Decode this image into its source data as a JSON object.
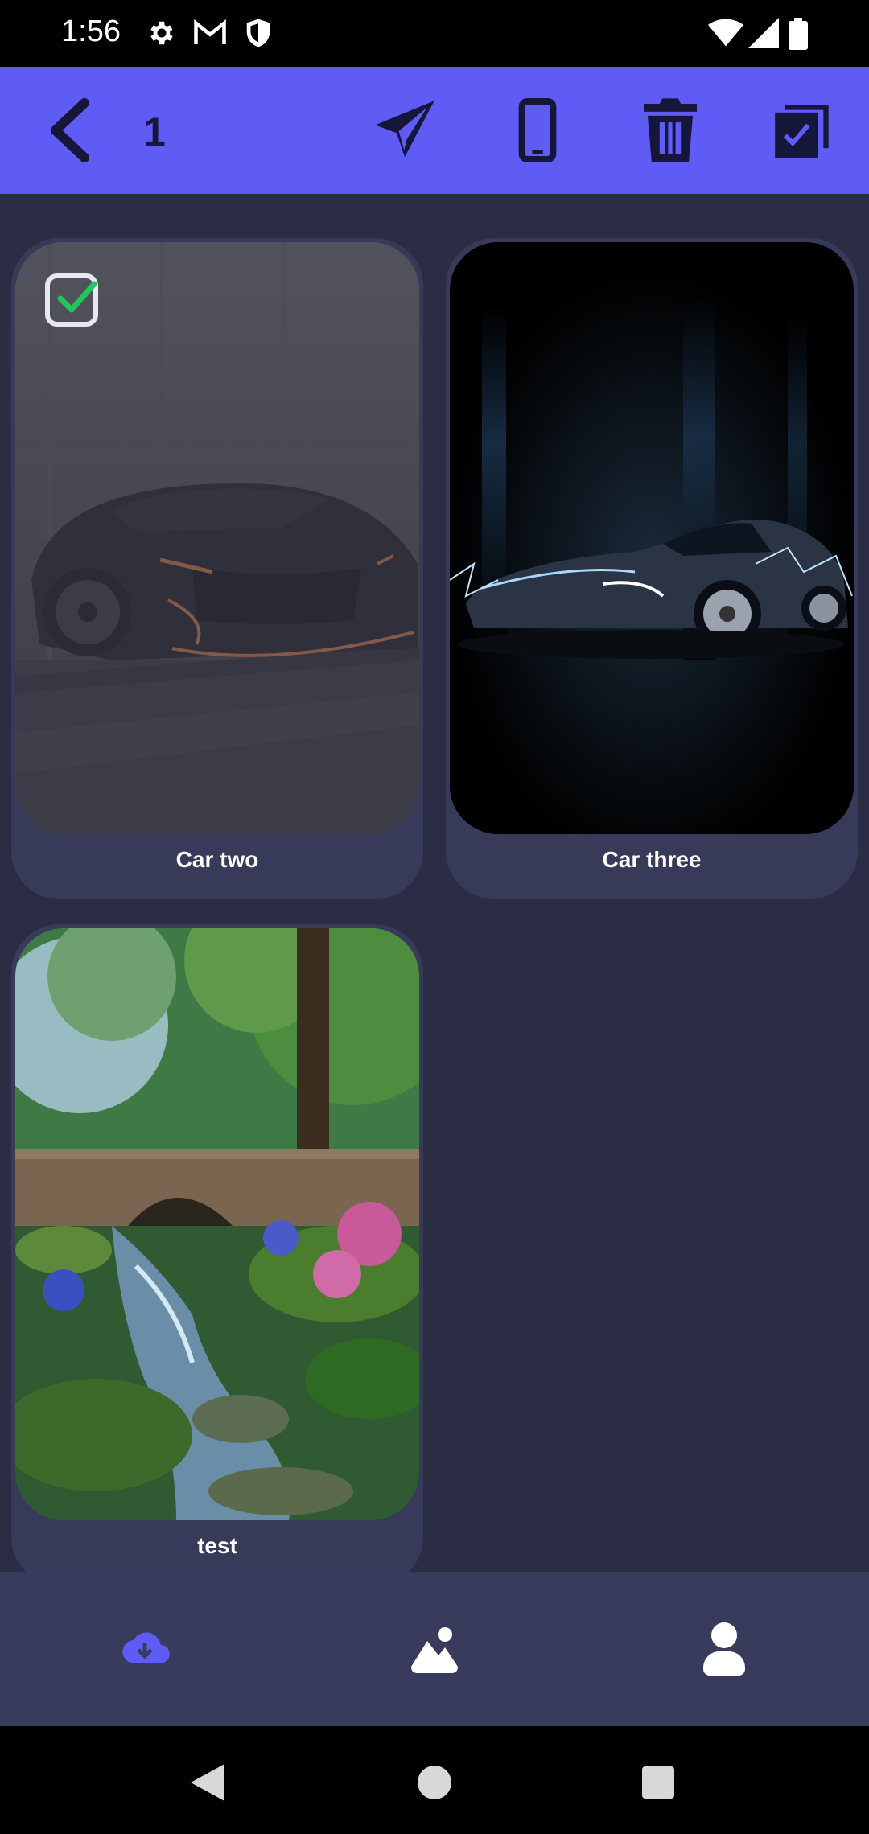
{
  "status_bar": {
    "time": "1:56",
    "icons": [
      "settings-icon",
      "gmail-icon",
      "shield-icon",
      "wifi-icon",
      "signal-icon",
      "battery-icon"
    ]
  },
  "app_bar": {
    "selected_count": "1",
    "actions": [
      "back-icon",
      "send-icon",
      "phone-icon",
      "delete-icon",
      "select-all-icon"
    ]
  },
  "wallpapers": [
    {
      "title": "Car two",
      "selected": true
    },
    {
      "title": "Car three",
      "selected": false
    },
    {
      "title": "test",
      "selected": false
    }
  ],
  "bottom_nav": {
    "items": [
      {
        "icon": "cloud-download-icon",
        "active": true
      },
      {
        "icon": "landscape-icon",
        "active": false
      },
      {
        "icon": "person-icon",
        "active": false
      }
    ]
  },
  "colors": {
    "accent": "#5e5cf5",
    "background": "#2b2d45",
    "card": "#383a5a",
    "nav": "#393b5c",
    "check": "#22c55e"
  }
}
